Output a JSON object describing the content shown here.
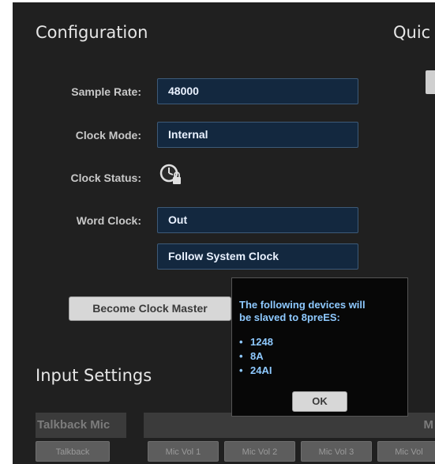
{
  "config": {
    "title": "Configuration",
    "quick_title_partial": "Quic",
    "sample_rate": {
      "label": "Sample Rate:",
      "value": "48000"
    },
    "clock_mode": {
      "label": "Clock Mode:",
      "value": "Internal"
    },
    "clock_status": {
      "label": "Clock Status:",
      "icon": "clock-lock-icon"
    },
    "word_clock": {
      "label": "Word Clock:",
      "value": "Out",
      "follow_value": "Follow System Clock"
    },
    "become_master_label": "Become Clock Master"
  },
  "dialog": {
    "message_line1": "The following devices will",
    "message_line2": "be slaved to 8preES:",
    "devices": [
      "1248",
      "8A",
      "24AI"
    ],
    "ok_label": "OK"
  },
  "input_settings": {
    "title": "Input Settings",
    "talkback_label": "Talkback Mic",
    "right_header_partial": "M",
    "talkback_button": "Talkback",
    "mic_buttons": [
      "Mic Vol 1",
      "Mic Vol 2",
      "Mic Vol 3",
      "Mic Vol"
    ]
  },
  "colors": {
    "background": "#202020",
    "field_bg": "#13283f",
    "dialog_text": "#8ec9ff"
  }
}
